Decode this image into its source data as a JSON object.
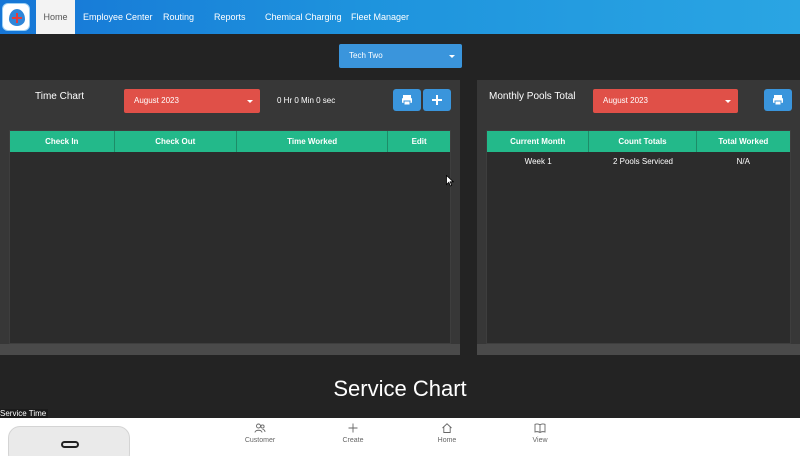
{
  "nav": {
    "items": [
      {
        "label": "Home",
        "active": true
      },
      {
        "label": "Employee Center"
      },
      {
        "label": "Routing"
      },
      {
        "label": "Reports"
      },
      {
        "label": "Chemical Charging"
      },
      {
        "label": "Fleet Manager"
      }
    ]
  },
  "tech_select": {
    "value": "Tech Two"
  },
  "time_chart": {
    "title": "Time Chart",
    "month_select": "August 2023",
    "total_time": "0 Hr 0 Min 0 sec",
    "columns": [
      "Check In",
      "Check Out",
      "Time Worked",
      "Edit"
    ]
  },
  "monthly_pools": {
    "title": "Monthly Pools Total",
    "month_select": "August 2023",
    "columns": [
      "Current Month",
      "Count Totals",
      "Total Worked"
    ],
    "rows": [
      [
        "Week 1",
        "2 Pools Serviced",
        "N/A"
      ]
    ]
  },
  "service_chart": {
    "title": "Service Chart",
    "subtitle": "Service Time"
  },
  "bottom_bar": {
    "items": [
      {
        "label": "Customer",
        "icon": "users-icon"
      },
      {
        "label": "Create",
        "icon": "plus-icon"
      },
      {
        "label": "Home",
        "icon": "home-icon"
      },
      {
        "label": "View",
        "icon": "book-icon"
      }
    ]
  },
  "colors": {
    "nav_gradient_start": "#1676d6",
    "nav_gradient_end": "#2aa5e3",
    "primary_button": "#3a95dc",
    "month_select": "#e05048",
    "table_header": "#23b98a",
    "background": "#232323"
  }
}
